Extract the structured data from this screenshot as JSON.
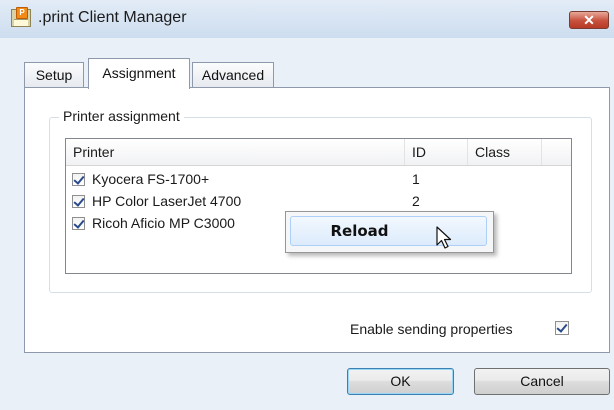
{
  "window": {
    "title": ".print Client Manager",
    "close_label": "✕",
    "icon_badge": "P"
  },
  "tabs": [
    {
      "label": "Setup",
      "active": false
    },
    {
      "label": "Assignment",
      "active": true
    },
    {
      "label": "Advanced",
      "active": false
    }
  ],
  "printer_assignment": {
    "group_title": "Printer assignment",
    "columns": [
      "Printer",
      "ID",
      "Class"
    ],
    "rows": [
      {
        "checked": true,
        "printer": "Kyocera FS-1700+",
        "id": "1",
        "class": ""
      },
      {
        "checked": true,
        "printer": "HP Color LaserJet 4700",
        "id": "2",
        "class": ""
      },
      {
        "checked": true,
        "printer": "Ricoh Aficio MP C3000",
        "id": "",
        "class": ""
      }
    ]
  },
  "context_menu": {
    "items": [
      {
        "label": "Reload",
        "highlighted": true
      }
    ]
  },
  "options": {
    "enable_sending_properties_label": "Enable sending properties",
    "enable_sending_properties_checked": true
  },
  "buttons": {
    "ok_label": "OK",
    "cancel_label": "Cancel"
  },
  "colors": {
    "checkmark": "#2a4a8c",
    "close_button": "#c7503c",
    "menu_highlight": "#dcebfc"
  }
}
